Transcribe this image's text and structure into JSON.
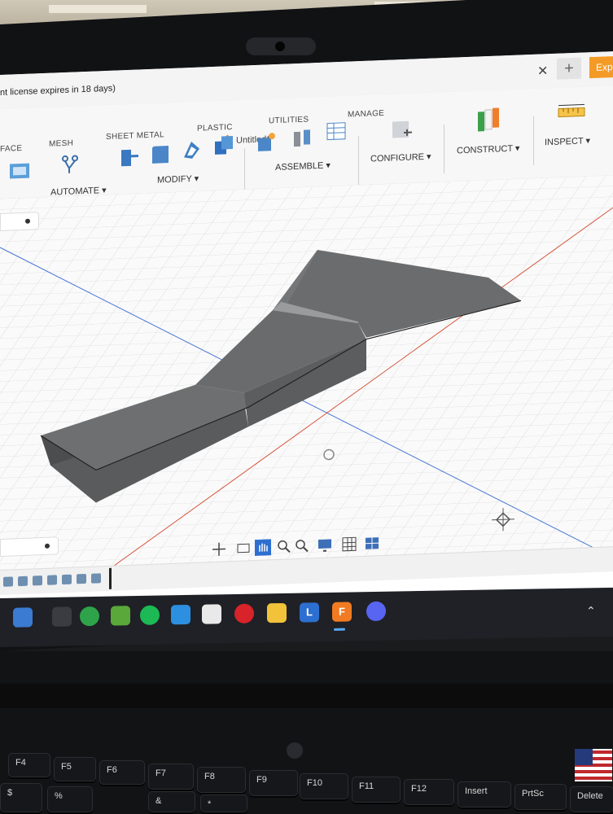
{
  "app": {
    "license_text": "nt license expires in 18 days)",
    "doc_title": "Untitled*",
    "explore_label": "Exp",
    "plus_label": "+",
    "close_label": "✕"
  },
  "ribbon": {
    "tabs": [
      "FACE",
      "MESH",
      "SHEET METAL",
      "PLASTIC",
      "UTILITIES",
      "MANAGE"
    ],
    "groups": {
      "automate": "AUTOMATE ▾",
      "modify": "MODIFY ▾",
      "assemble": "ASSEMBLE ▾",
      "configure": "CONFIGURE ▾",
      "construct": "CONSTRUCT ▾",
      "inspect": "INSPECT ▾"
    }
  },
  "colors": {
    "accent": "#f49a26",
    "grid_axis_blue": "#4a78d6",
    "grid_axis_red": "#d6553c",
    "model_dark": "#5a5b5d",
    "model_light": "#7c7d7f"
  },
  "icons": {
    "taskbar": [
      "widgets-icon",
      "task-view-icon",
      "xbox-icon",
      "minecraft-icon",
      "spotify-icon",
      "sync-icon",
      "store-icon",
      "opera-icon",
      "file-explorer-icon",
      "l-app-icon",
      "fusion-360-icon",
      "discord-icon"
    ],
    "fusion_badge": "F"
  },
  "keyboard": {
    "keys": [
      "F4",
      "F5",
      "F6",
      "F7",
      "F8",
      "F9",
      "F10",
      "F11",
      "F12",
      "Insert",
      "PrtSc",
      "Delete"
    ],
    "bottom_row": [
      "$",
      "%",
      "&",
      "*"
    ]
  }
}
